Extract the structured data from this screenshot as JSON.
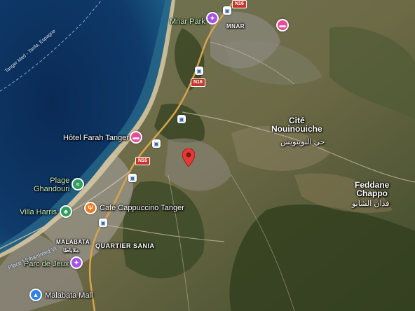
{
  "map": {
    "places": {
      "mnar_park": "Mnar Park",
      "mnar": "MNAR",
      "cite_nouinouiche": "Cité\nNouinouiche",
      "cite_nouinouiche_ar": "حي النوينويش",
      "feddane_chappo": "Feddane\nChappo",
      "feddane_chappo_ar": "فدان الشابو",
      "hotel_farah": "Hôtel Farah Tanger",
      "plage_ghandouri": "Plage\nGhandouri",
      "villa_harris": "Villa Harris",
      "cafe_cappuccino": "Café Cappuccino Tanger",
      "malabata": "MALABATA",
      "malabata_ar": "ملاباطا",
      "quartier_sania": "QUARTIER SANIA",
      "parc_de_jeux": "Parc de Jeux",
      "malabata_mall": "Malabata Mall",
      "ferry_route": "Tanger Med - Tarifa, Espagne",
      "route_place": "Place Mohammed VI"
    },
    "road_shields": [
      "N16",
      "N16",
      "N16"
    ],
    "icons": {
      "mnar_park": "amusement-park-icon",
      "hotel_farah": "hotel-icon",
      "hotel_north": "hotel-icon",
      "plage": "beach-icon",
      "villa_harris": "park-icon",
      "cafe": "restaurant-icon",
      "parc_de_jeux": "amusement-park-icon",
      "mall": "shopping-bag-icon",
      "selected": "map-pin-icon"
    },
    "colors": {
      "sea": "#0d2e57",
      "pin": "#e53935",
      "hotel": "#e64c9c",
      "attraction": "#a453e3",
      "park": "#2f9e5e",
      "food": "#f07b1e",
      "shop": "#2f83e6"
    }
  }
}
